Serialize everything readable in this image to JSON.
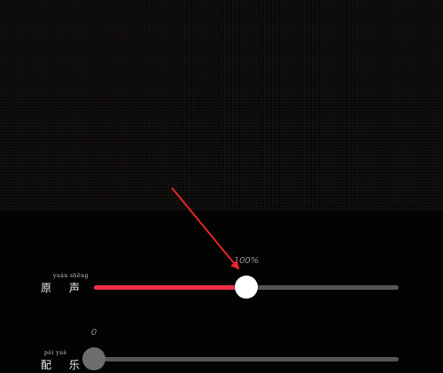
{
  "preview": {
    "icon": "video-preview"
  },
  "sliders": [
    {
      "id": "original-sound",
      "pinyin": "yuán shēng",
      "label": "原 声",
      "value_text": "100%",
      "fraction": 0.5,
      "fill_color": "#f0304a",
      "thumb_color": "#ffffff"
    },
    {
      "id": "background-music",
      "pinyin": "pèi yuè",
      "label": "配 乐",
      "value_text": "0",
      "fraction": 0.0,
      "thumb_color": "#6d6d6d"
    }
  ],
  "annotation": {
    "type": "arrow",
    "color": "#e8252b"
  }
}
